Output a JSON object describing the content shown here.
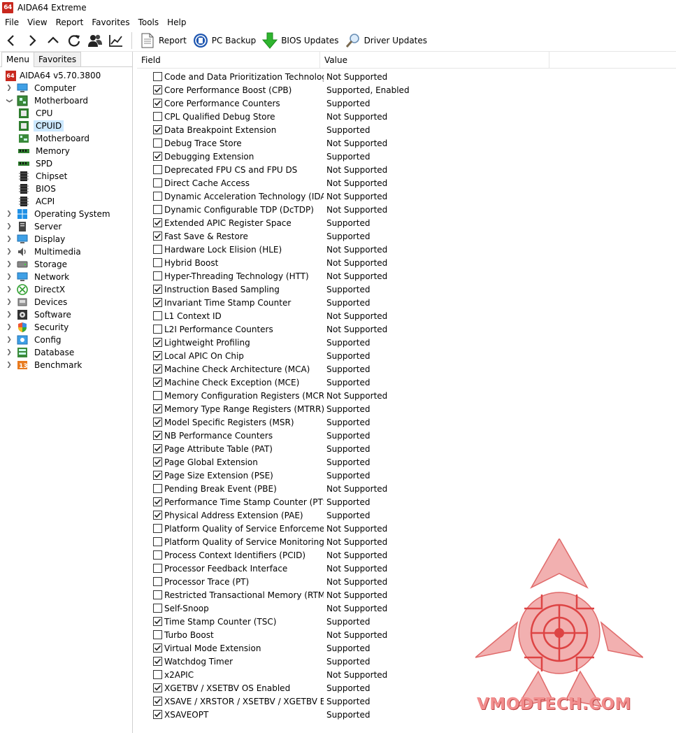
{
  "window": {
    "title": "AIDA64 Extreme",
    "logo_text": "64"
  },
  "menu": [
    "File",
    "View",
    "Report",
    "Favorites",
    "Tools",
    "Help"
  ],
  "toolbar": {
    "report": "Report",
    "pc_backup": "PC Backup",
    "bios_updates": "BIOS Updates",
    "driver_updates": "Driver Updates"
  },
  "tabs": {
    "menu": "Menu",
    "favorites": "Favorites"
  },
  "tree": {
    "root": "AIDA64 v5.70.3800",
    "items": [
      {
        "label": "Computer"
      },
      {
        "label": "Motherboard",
        "children": [
          "CPU",
          "CPUID",
          "Motherboard",
          "Memory",
          "SPD",
          "Chipset",
          "BIOS",
          "ACPI"
        ]
      },
      {
        "label": "Operating System"
      },
      {
        "label": "Server"
      },
      {
        "label": "Display"
      },
      {
        "label": "Multimedia"
      },
      {
        "label": "Storage"
      },
      {
        "label": "Network"
      },
      {
        "label": "DirectX"
      },
      {
        "label": "Devices"
      },
      {
        "label": "Software"
      },
      {
        "label": "Security"
      },
      {
        "label": "Config"
      },
      {
        "label": "Database"
      },
      {
        "label": "Benchmark"
      }
    ],
    "selected": "CPUID"
  },
  "columns": {
    "field": "Field",
    "value": "Value"
  },
  "rows": [
    {
      "field": "Code and Data Prioritization Technolog...",
      "value": "Not Supported",
      "checked": false
    },
    {
      "field": "Core Performance Boost (CPB)",
      "value": "Supported, Enabled",
      "checked": true
    },
    {
      "field": "Core Performance Counters",
      "value": "Supported",
      "checked": true
    },
    {
      "field": "CPL Qualified Debug Store",
      "value": "Not Supported",
      "checked": false
    },
    {
      "field": "Data Breakpoint Extension",
      "value": "Supported",
      "checked": true
    },
    {
      "field": "Debug Trace Store",
      "value": "Not Supported",
      "checked": false
    },
    {
      "field": "Debugging Extension",
      "value": "Supported",
      "checked": true
    },
    {
      "field": "Deprecated FPU CS and FPU DS",
      "value": "Not Supported",
      "checked": false
    },
    {
      "field": "Direct Cache Access",
      "value": "Not Supported",
      "checked": false
    },
    {
      "field": "Dynamic Acceleration Technology (IDA)",
      "value": "Not Supported",
      "checked": false
    },
    {
      "field": "Dynamic Configurable TDP (DcTDP)",
      "value": "Not Supported",
      "checked": false
    },
    {
      "field": "Extended APIC Register Space",
      "value": "Supported",
      "checked": true
    },
    {
      "field": "Fast Save & Restore",
      "value": "Supported",
      "checked": true
    },
    {
      "field": "Hardware Lock Elision (HLE)",
      "value": "Not Supported",
      "checked": false
    },
    {
      "field": "Hybrid Boost",
      "value": "Not Supported",
      "checked": false
    },
    {
      "field": "Hyper-Threading Technology (HTT)",
      "value": "Not Supported",
      "checked": false
    },
    {
      "field": "Instruction Based Sampling",
      "value": "Supported",
      "checked": true
    },
    {
      "field": "Invariant Time Stamp Counter",
      "value": "Supported",
      "checked": true
    },
    {
      "field": "L1 Context ID",
      "value": "Not Supported",
      "checked": false
    },
    {
      "field": "L2I Performance Counters",
      "value": "Not Supported",
      "checked": false
    },
    {
      "field": "Lightweight Profiling",
      "value": "Supported",
      "checked": true
    },
    {
      "field": "Local APIC On Chip",
      "value": "Supported",
      "checked": true
    },
    {
      "field": "Machine Check Architecture (MCA)",
      "value": "Supported",
      "checked": true
    },
    {
      "field": "Machine Check Exception (MCE)",
      "value": "Supported",
      "checked": true
    },
    {
      "field": "Memory Configuration Registers (MCR)",
      "value": "Not Supported",
      "checked": false
    },
    {
      "field": "Memory Type Range Registers (MTRR)",
      "value": "Supported",
      "checked": true
    },
    {
      "field": "Model Specific Registers (MSR)",
      "value": "Supported",
      "checked": true
    },
    {
      "field": "NB Performance Counters",
      "value": "Supported",
      "checked": true
    },
    {
      "field": "Page Attribute Table (PAT)",
      "value": "Supported",
      "checked": true
    },
    {
      "field": "Page Global Extension",
      "value": "Supported",
      "checked": true
    },
    {
      "field": "Page Size Extension (PSE)",
      "value": "Supported",
      "checked": true
    },
    {
      "field": "Pending Break Event (PBE)",
      "value": "Not Supported",
      "checked": false
    },
    {
      "field": "Performance Time Stamp Counter (PTSC)",
      "value": "Supported",
      "checked": true
    },
    {
      "field": "Physical Address Extension (PAE)",
      "value": "Supported",
      "checked": true
    },
    {
      "field": "Platform Quality of Service Enforcemen...",
      "value": "Not Supported",
      "checked": false
    },
    {
      "field": "Platform Quality of Service Monitoring (...",
      "value": "Not Supported",
      "checked": false
    },
    {
      "field": "Process Context Identifiers (PCID)",
      "value": "Not Supported",
      "checked": false
    },
    {
      "field": "Processor Feedback Interface",
      "value": "Not Supported",
      "checked": false
    },
    {
      "field": "Processor Trace (PT)",
      "value": "Not Supported",
      "checked": false
    },
    {
      "field": "Restricted Transactional Memory (RTM)",
      "value": "Not Supported",
      "checked": false
    },
    {
      "field": "Self-Snoop",
      "value": "Not Supported",
      "checked": false
    },
    {
      "field": "Time Stamp Counter (TSC)",
      "value": "Supported",
      "checked": true
    },
    {
      "field": "Turbo Boost",
      "value": "Not Supported",
      "checked": false
    },
    {
      "field": "Virtual Mode Extension",
      "value": "Supported",
      "checked": true
    },
    {
      "field": "Watchdog Timer",
      "value": "Supported",
      "checked": true
    },
    {
      "field": "x2APIC",
      "value": "Not Supported",
      "checked": false
    },
    {
      "field": "XGETBV / XSETBV OS Enabled",
      "value": "Supported",
      "checked": true
    },
    {
      "field": "XSAVE / XRSTOR / XSETBV / XGETBV Ext...",
      "value": "Supported",
      "checked": true
    },
    {
      "field": "XSAVEOPT",
      "value": "Supported",
      "checked": true
    }
  ],
  "watermark": {
    "text": "VMODTECH.COM"
  },
  "colors": {
    "accent": "#cce8ff",
    "logo": "#c8281e",
    "watermark": "#f28d8d"
  }
}
